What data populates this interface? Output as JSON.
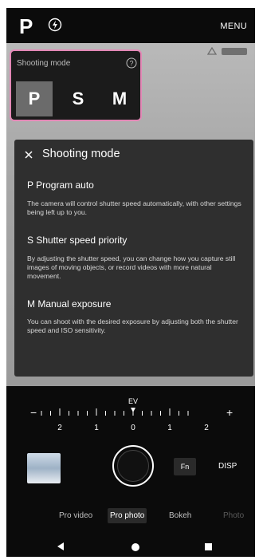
{
  "topbar": {
    "mode": "P",
    "menu_label": "MENU"
  },
  "mode_panel": {
    "title": "Shooting mode",
    "modes": [
      "P",
      "S",
      "M"
    ],
    "selected": "P"
  },
  "help": {
    "title": "Shooting mode",
    "sections": [
      {
        "heading": "P Program auto",
        "body": "The camera will control shutter speed automatically, with other settings being left up to you."
      },
      {
        "heading": "S Shutter speed priority",
        "body": "By adjusting the shutter speed, you can change how you capture still images of moving objects, or record videos with more natural movement."
      },
      {
        "heading": "M Manual exposure",
        "body": "You can shoot with the desired exposure by adjusting both the shutter speed and ISO sensitivity."
      }
    ]
  },
  "ev": {
    "label": "EV",
    "minus": "−",
    "plus": "+",
    "ticks": [
      "2",
      "1",
      "0",
      "1",
      "2"
    ]
  },
  "controls": {
    "fn_label": "Fn",
    "disp_label": "DISP"
  },
  "tabs": [
    "Pro video",
    "Pro photo",
    "Bokeh",
    "Photo"
  ],
  "active_tab": "Pro photo",
  "colors": {
    "highlight": "#e388b6",
    "panel_bg": "#2f2f2f"
  }
}
